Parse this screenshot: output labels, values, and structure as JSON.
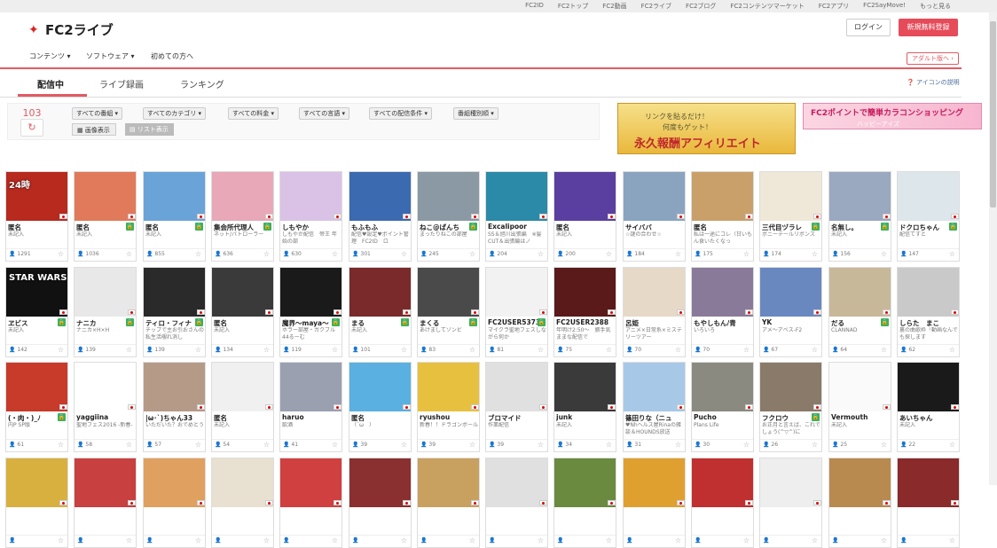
{
  "topbar": {
    "links": [
      "FC2ID",
      "FC2トップ",
      "FC2動画",
      "FC2ライブ",
      "FC2ブログ",
      "FC2コンテンツマーケット",
      "FC2アプリ",
      "FC2SayMove!",
      "もっと見る"
    ]
  },
  "header": {
    "logo": "FC2ライブ",
    "login": "ログイン",
    "signup": "新規無料登録"
  },
  "nav": {
    "items": [
      "コンテンツ ▾",
      "ソフトウェア ▾",
      "初めての方へ"
    ],
    "adult": "アダルト版へ ›"
  },
  "tabs": {
    "items": [
      "配信中",
      "ライブ録画",
      "ランキング"
    ],
    "help": "アイコンの説明"
  },
  "filters": {
    "count": "103",
    "selects": [
      "すべての番組",
      "すべてのカテゴリ",
      "すべての料金",
      "すべての言語",
      "すべての配信条件",
      "番組種別順"
    ],
    "view_image": "画像表示",
    "view_list": "リスト表示"
  },
  "ads": {
    "ad1_line1": "リンクを貼るだけ！",
    "ad1_line2": "何度もゲット！",
    "ad1_line3": "永久報酬アフィリエイト",
    "ad2_line1": "FC2ポイントで簡単カラコンショッピング",
    "ad2_line2": "ハッピーアイズ"
  },
  "colors": {
    "accent": "#e35a63",
    "lock": "#3ab25a"
  },
  "rows": [
    [
      {
        "name": "匿名",
        "desc": "未記入",
        "viewers": "1291",
        "lock": false,
        "bg": "#b8291e",
        "thumb": "24時"
      },
      {
        "name": "匿名",
        "desc": "未記入",
        "viewers": "1036",
        "lock": true,
        "bg": "#e07a5a",
        "thumb": ""
      },
      {
        "name": "匿名",
        "desc": "未記入",
        "viewers": "855",
        "lock": true,
        "bg": "#6aa3d8",
        "thumb": ""
      },
      {
        "name": "集会所代理人",
        "desc": "ネット/パトローラー",
        "viewers": "636",
        "lock": true,
        "bg": "#e8a8b8",
        "thumb": ""
      },
      {
        "name": "しもやか",
        "desc": "しもやか配信　帝王 年始の部",
        "viewers": "630",
        "lock": false,
        "bg": "#d9c2e6",
        "thumb": ""
      },
      {
        "name": "もふもふ",
        "desc": "配信♥設定♥ポイント管理　FC2ID　ロ",
        "viewers": "301",
        "lock": false,
        "bg": "#3b6ab0",
        "thumb": ""
      },
      {
        "name": "ねこ@ぱんち",
        "desc": "まったりねこの部屋",
        "viewers": "245",
        "lock": true,
        "bg": "#8b99a5",
        "thumb": ""
      },
      {
        "name": "Excalipoor",
        "desc": "SS＆旭川出張編　※髪CUT＆出張編はノ",
        "viewers": "204",
        "lock": false,
        "bg": "#2a8aa8",
        "thumb": ""
      },
      {
        "name": "匿名",
        "desc": "未記入",
        "viewers": "200",
        "lock": false,
        "bg": "#5a3fa0",
        "thumb": ""
      },
      {
        "name": "サイババ",
        "desc": "☆謎の合わせ☆",
        "viewers": "184",
        "lock": false,
        "bg": "#8aa4c0",
        "thumb": ""
      },
      {
        "name": "匿名",
        "desc": "私は一途にコレ（甘いもん食いたくなっ",
        "viewers": "175",
        "lock": false,
        "bg": "#c9a06a",
        "thumb": ""
      },
      {
        "name": "三代目ヅラレ",
        "desc": "ボニーテールリボンズ",
        "viewers": "174",
        "lock": true,
        "bg": "#efe8d8",
        "thumb": ""
      },
      {
        "name": "名無し。",
        "desc": "未記入",
        "viewers": "156",
        "lock": true,
        "bg": "#9aa8c0",
        "thumb": ""
      },
      {
        "name": "ドクロちゃん",
        "desc": "配信てすと",
        "viewers": "147",
        "lock": true,
        "bg": "#dde6ea",
        "thumb": ""
      }
    ],
    [
      {
        "name": "ヱビス",
        "desc": "未記入",
        "viewers": "142",
        "lock": true,
        "bg": "#111",
        "thumb": "STAR WARS"
      },
      {
        "name": "ナニカ",
        "desc": "ナニカ×H×H",
        "viewers": "139",
        "lock": true,
        "bg": "#e8e8e8",
        "thumb": ""
      },
      {
        "name": "ティロ・フィナ",
        "desc": "チップで主お引おさんの私生活覗れ消し",
        "viewers": "139",
        "lock": true,
        "bg": "#2a2a2a",
        "thumb": ""
      },
      {
        "name": "匿名",
        "desc": "未記入",
        "viewers": "134",
        "lock": false,
        "bg": "#3a3a3a",
        "thumb": ""
      },
      {
        "name": "魔界～maya～",
        "desc": "ホラー部屋・ガクブル44るーむ",
        "viewers": "119",
        "lock": true,
        "bg": "#1a1a1a",
        "thumb": ""
      },
      {
        "name": "まる",
        "desc": "未記入",
        "viewers": "101",
        "lock": true,
        "bg": "#7a2a2a",
        "thumb": ""
      },
      {
        "name": "まくる",
        "desc": "あけましてゾンビ",
        "viewers": "83",
        "lock": true,
        "bg": "#4a4a4a",
        "thumb": ""
      },
      {
        "name": "FC2USER5373",
        "desc": "マイクラ聖地フェスしながら何か",
        "viewers": "81",
        "lock": true,
        "bg": "#f2f2f2",
        "thumb": ""
      },
      {
        "name": "FC2USER2388",
        "desc": "年明け2:50～　勝手気ままな配信で",
        "viewers": "75",
        "lock": false,
        "bg": "#5a1a1a",
        "thumb": ""
      },
      {
        "name": "呂姫",
        "desc": "アニメ×日常系×ミステリーツアー",
        "viewers": "70",
        "lock": false,
        "bg": "#e6d9c8",
        "thumb": ""
      },
      {
        "name": "もやしもん/青",
        "desc": "いろいろ",
        "viewers": "70",
        "lock": false,
        "bg": "#8a7a9a",
        "thumb": ""
      },
      {
        "name": "YK",
        "desc": "アメ～アベス-F2",
        "viewers": "67",
        "lock": false,
        "bg": "#6a88c0",
        "thumb": ""
      },
      {
        "name": "だる",
        "desc": "CLANNAD",
        "viewers": "64",
        "lock": true,
        "bg": "#c8b89a",
        "thumb": ""
      },
      {
        "name": "しらた　まこ",
        "desc": "裏の曲歌枠「動画なんでも探します",
        "viewers": "62",
        "lock": false,
        "bg": "#c9c9c9",
        "thumb": ""
      }
    ],
    [
      {
        "name": "(・肉・)_ﾉ",
        "desc": "内P SP版",
        "viewers": "61",
        "lock": true,
        "bg": "#c83a2a",
        "thumb": ""
      },
      {
        "name": "yaggiina",
        "desc": "聖地フェス2016 -新春-",
        "viewers": "58",
        "lock": false,
        "bg": "#fff",
        "thumb": ""
      },
      {
        "name": "|ω･`)ちゃん33",
        "desc": "いただいた？おでめとう",
        "viewers": "57",
        "lock": false,
        "bg": "#b59a88",
        "thumb": ""
      },
      {
        "name": "匿名",
        "desc": "未記入",
        "viewers": "54",
        "lock": false,
        "bg": "#f0f0f0",
        "thumb": ""
      },
      {
        "name": "haruo",
        "desc": "飲酒",
        "viewers": "41",
        "lock": false,
        "bg": "#9aa0b0",
        "thumb": ""
      },
      {
        "name": "匿名",
        "desc": "（´ω｀）",
        "viewers": "39",
        "lock": false,
        "bg": "#5ab0e0",
        "thumb": ""
      },
      {
        "name": "ryushou",
        "desc": "新春！！ドラゴンボール",
        "viewers": "39",
        "lock": false,
        "bg": "#e8c040",
        "thumb": ""
      },
      {
        "name": "ブロマイド",
        "desc": "作業配信",
        "viewers": "39",
        "lock": false,
        "bg": "#e0e0e0",
        "thumb": ""
      },
      {
        "name": "junk",
        "desc": "未記入",
        "viewers": "34",
        "lock": false,
        "bg": "#3a3a3a",
        "thumb": ""
      },
      {
        "name": "篠田りな（ニュ",
        "desc": "♥Nhヘルス屋Rinaの雑談＆HOUNDS放送",
        "viewers": "31",
        "lock": false,
        "bg": "#a8c8e8",
        "thumb": ""
      },
      {
        "name": "Pucho",
        "desc": "Plans Life",
        "viewers": "30",
        "lock": false,
        "bg": "#8a8a80",
        "thumb": ""
      },
      {
        "name": "フクロウ",
        "desc": "お正月と言えば、これでしょう(^▽^)に",
        "viewers": "26",
        "lock": true,
        "bg": "#8a7a6a",
        "thumb": ""
      },
      {
        "name": "Vermouth",
        "desc": "未記入",
        "viewers": "25",
        "lock": false,
        "bg": "#fafafa",
        "thumb": ""
      },
      {
        "name": "あいちゃん",
        "desc": "未記入",
        "viewers": "22",
        "lock": false,
        "bg": "#1a1a1a",
        "thumb": ""
      }
    ],
    [
      {
        "name": "",
        "desc": "",
        "viewers": "",
        "lock": false,
        "bg": "#d8b040",
        "thumb": ""
      },
      {
        "name": "",
        "desc": "",
        "viewers": "",
        "lock": false,
        "bg": "#c84040",
        "thumb": ""
      },
      {
        "name": "",
        "desc": "",
        "viewers": "",
        "lock": false,
        "bg": "#e0a060",
        "thumb": ""
      },
      {
        "name": "",
        "desc": "",
        "viewers": "",
        "lock": false,
        "bg": "#e8e0d0",
        "thumb": ""
      },
      {
        "name": "",
        "desc": "",
        "viewers": "",
        "lock": false,
        "bg": "#d04040",
        "thumb": ""
      },
      {
        "name": "",
        "desc": "",
        "viewers": "",
        "lock": false,
        "bg": "#8a3030",
        "thumb": ""
      },
      {
        "name": "",
        "desc": "",
        "viewers": "",
        "lock": false,
        "bg": "#c8a060",
        "thumb": ""
      },
      {
        "name": "",
        "desc": "",
        "viewers": "",
        "lock": false,
        "bg": "#e0e0e0",
        "thumb": ""
      },
      {
        "name": "",
        "desc": "",
        "viewers": "",
        "lock": false,
        "bg": "#6a8a40",
        "thumb": ""
      },
      {
        "name": "",
        "desc": "",
        "viewers": "",
        "lock": false,
        "bg": "#e0a030",
        "thumb": ""
      },
      {
        "name": "",
        "desc": "",
        "viewers": "",
        "lock": false,
        "bg": "#c03030",
        "thumb": ""
      },
      {
        "name": "",
        "desc": "",
        "viewers": "",
        "lock": false,
        "bg": "#eee",
        "thumb": ""
      },
      {
        "name": "",
        "desc": "",
        "viewers": "",
        "lock": false,
        "bg": "#b88a50",
        "thumb": ""
      },
      {
        "name": "",
        "desc": "",
        "viewers": "",
        "lock": false,
        "bg": "#8a2a2a",
        "thumb": ""
      }
    ]
  ]
}
